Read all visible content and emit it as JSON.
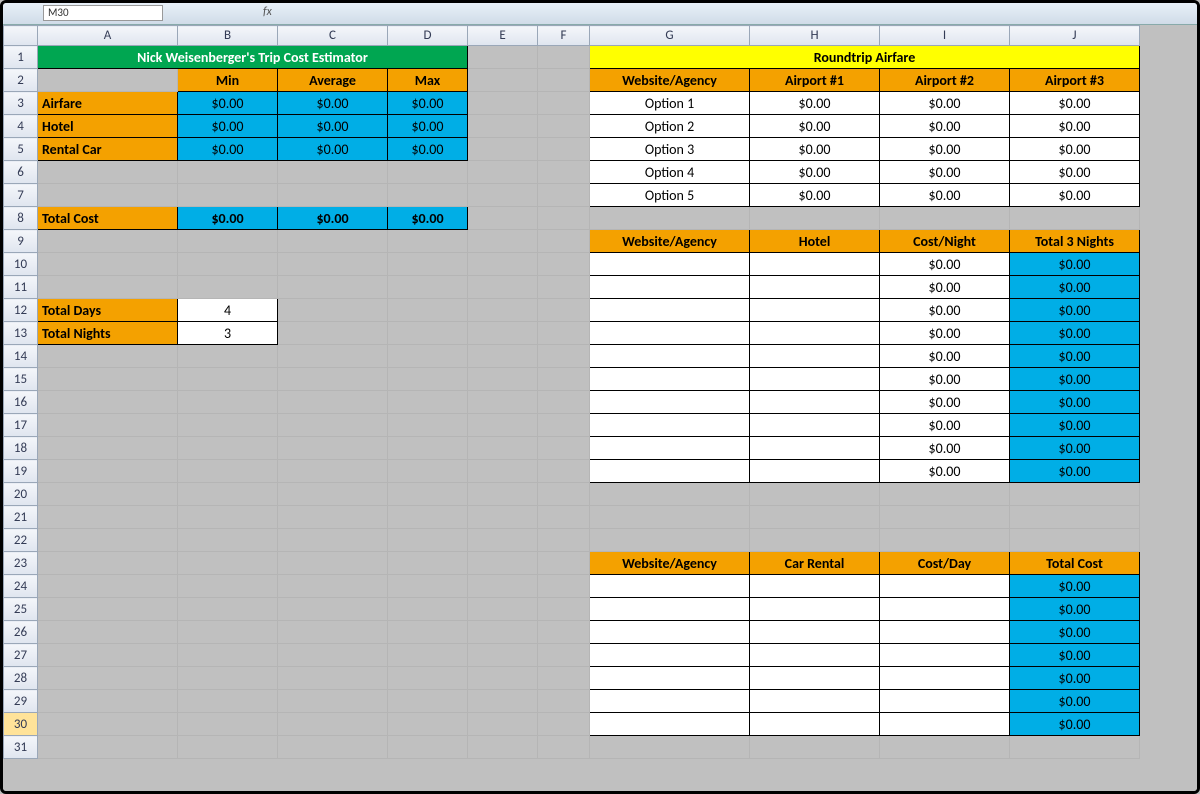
{
  "namebox": "M30",
  "columns": [
    "A",
    "B",
    "C",
    "D",
    "E",
    "F",
    "G",
    "H",
    "I",
    "J"
  ],
  "rows": [
    "1",
    "2",
    "3",
    "4",
    "5",
    "6",
    "7",
    "8",
    "9",
    "10",
    "11",
    "12",
    "13",
    "14",
    "15",
    "16",
    "17",
    "18",
    "19",
    "20",
    "21",
    "22",
    "23",
    "24",
    "25",
    "26",
    "27",
    "28",
    "29",
    "30",
    "31"
  ],
  "left": {
    "title": "Nick Weisenberger's Trip Cost Estimator",
    "headers": {
      "min": "Min",
      "avg": "Average",
      "max": "Max"
    },
    "rows": [
      {
        "label": "Airfare",
        "min": "$0.00",
        "avg": "$0.00",
        "max": "$0.00"
      },
      {
        "label": "Hotel",
        "min": "$0.00",
        "avg": "$0.00",
        "max": "$0.00"
      },
      {
        "label": "Rental Car",
        "min": "$0.00",
        "avg": "$0.00",
        "max": "$0.00"
      }
    ],
    "total": {
      "label": "Total Cost",
      "min": "$0.00",
      "avg": "$0.00",
      "max": "$0.00"
    },
    "days": {
      "label": "Total Days",
      "value": "4"
    },
    "nights": {
      "label": "Total Nights",
      "value": "3"
    }
  },
  "airfare": {
    "title": "Roundtrip Airfare",
    "headers": {
      "agency": "Website/Agency",
      "a1": "Airport #1",
      "a2": "Airport #2",
      "a3": "Airport #3"
    },
    "rows": [
      {
        "label": "Option 1",
        "a1": "$0.00",
        "a2": "$0.00",
        "a3": "$0.00"
      },
      {
        "label": "Option 2",
        "a1": "$0.00",
        "a2": "$0.00",
        "a3": "$0.00"
      },
      {
        "label": "Option 3",
        "a1": "$0.00",
        "a2": "$0.00",
        "a3": "$0.00"
      },
      {
        "label": "Option 4",
        "a1": "$0.00",
        "a2": "$0.00",
        "a3": "$0.00"
      },
      {
        "label": "Option 5",
        "a1": "$0.00",
        "a2": "$0.00",
        "a3": "$0.00"
      }
    ]
  },
  "hotel": {
    "headers": {
      "agency": "Website/Agency",
      "hotel": "Hotel",
      "cost": "Cost/Night",
      "total": "Total 3 Nights"
    },
    "rows": [
      {
        "cost": "$0.00",
        "total": "$0.00"
      },
      {
        "cost": "$0.00",
        "total": "$0.00"
      },
      {
        "cost": "$0.00",
        "total": "$0.00"
      },
      {
        "cost": "$0.00",
        "total": "$0.00"
      },
      {
        "cost": "$0.00",
        "total": "$0.00"
      },
      {
        "cost": "$0.00",
        "total": "$0.00"
      },
      {
        "cost": "$0.00",
        "total": "$0.00"
      },
      {
        "cost": "$0.00",
        "total": "$0.00"
      },
      {
        "cost": "$0.00",
        "total": "$0.00"
      },
      {
        "cost": "$0.00",
        "total": "$0.00"
      }
    ]
  },
  "car": {
    "headers": {
      "agency": "Website/Agency",
      "rental": "Car Rental",
      "cost": "Cost/Day",
      "total": "Total Cost"
    },
    "rows": [
      {
        "total": "$0.00"
      },
      {
        "total": "$0.00"
      },
      {
        "total": "$0.00"
      },
      {
        "total": "$0.00"
      },
      {
        "total": "$0.00"
      },
      {
        "total": "$0.00"
      },
      {
        "total": "$0.00"
      }
    ]
  }
}
